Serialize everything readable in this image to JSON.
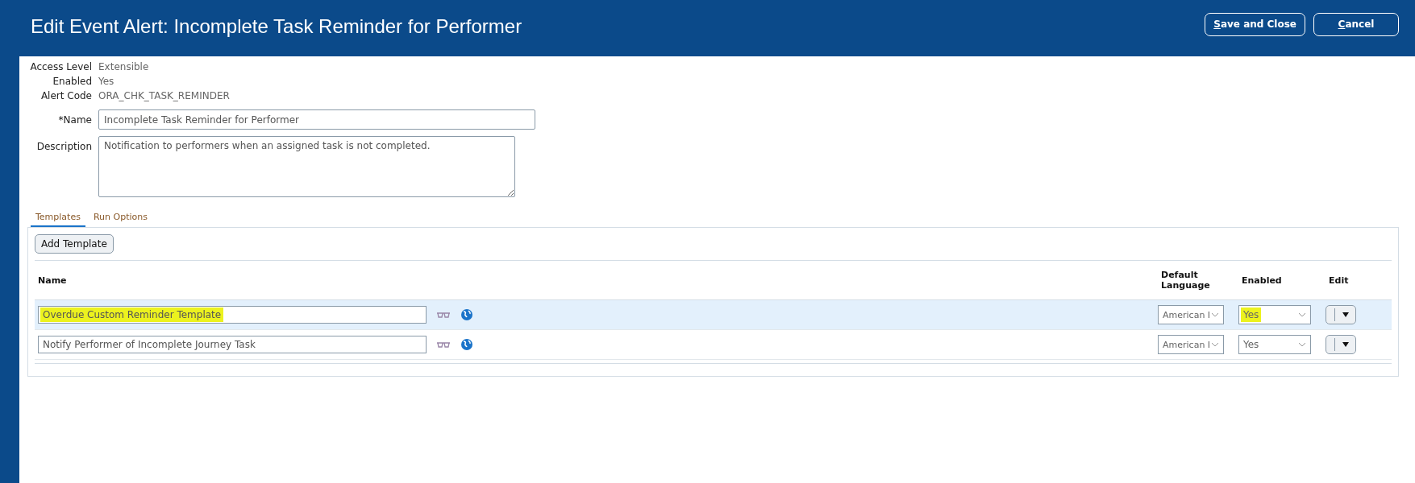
{
  "header": {
    "title": "Edit Event Alert: Incomplete Task Reminder for Performer",
    "buttons": [
      "Save and Close",
      "Cancel"
    ]
  },
  "info": [
    {
      "label": "Access Level",
      "value": "Extensible"
    },
    {
      "label": "Enabled",
      "value": "Yes"
    },
    {
      "label": "Alert Code",
      "value": "ORA_CHK_TASK_REMINDER"
    }
  ],
  "name_field": {
    "label": "*Name",
    "value": "Incomplete Task Reminder for Performer"
  },
  "description_field": {
    "label": "Description",
    "value": "Notification to performers when an assigned task is not completed."
  },
  "tabs": [
    {
      "label": "Templates",
      "selected": true
    },
    {
      "label": "Run Options",
      "selected": false
    }
  ],
  "add_button": "Add Template",
  "table": {
    "columns": [
      "Name",
      "Default Language",
      "Enabled",
      "Edit"
    ],
    "rows": [
      {
        "name": "Overdue Custom Reminder Template",
        "language": "American I",
        "enabled": "Yes",
        "selected": true,
        "highlighted": true
      },
      {
        "name": "Notify Performer of Incomplete Journey Task",
        "language": "American I",
        "enabled": "Yes",
        "selected": false,
        "highlighted": false
      }
    ]
  }
}
